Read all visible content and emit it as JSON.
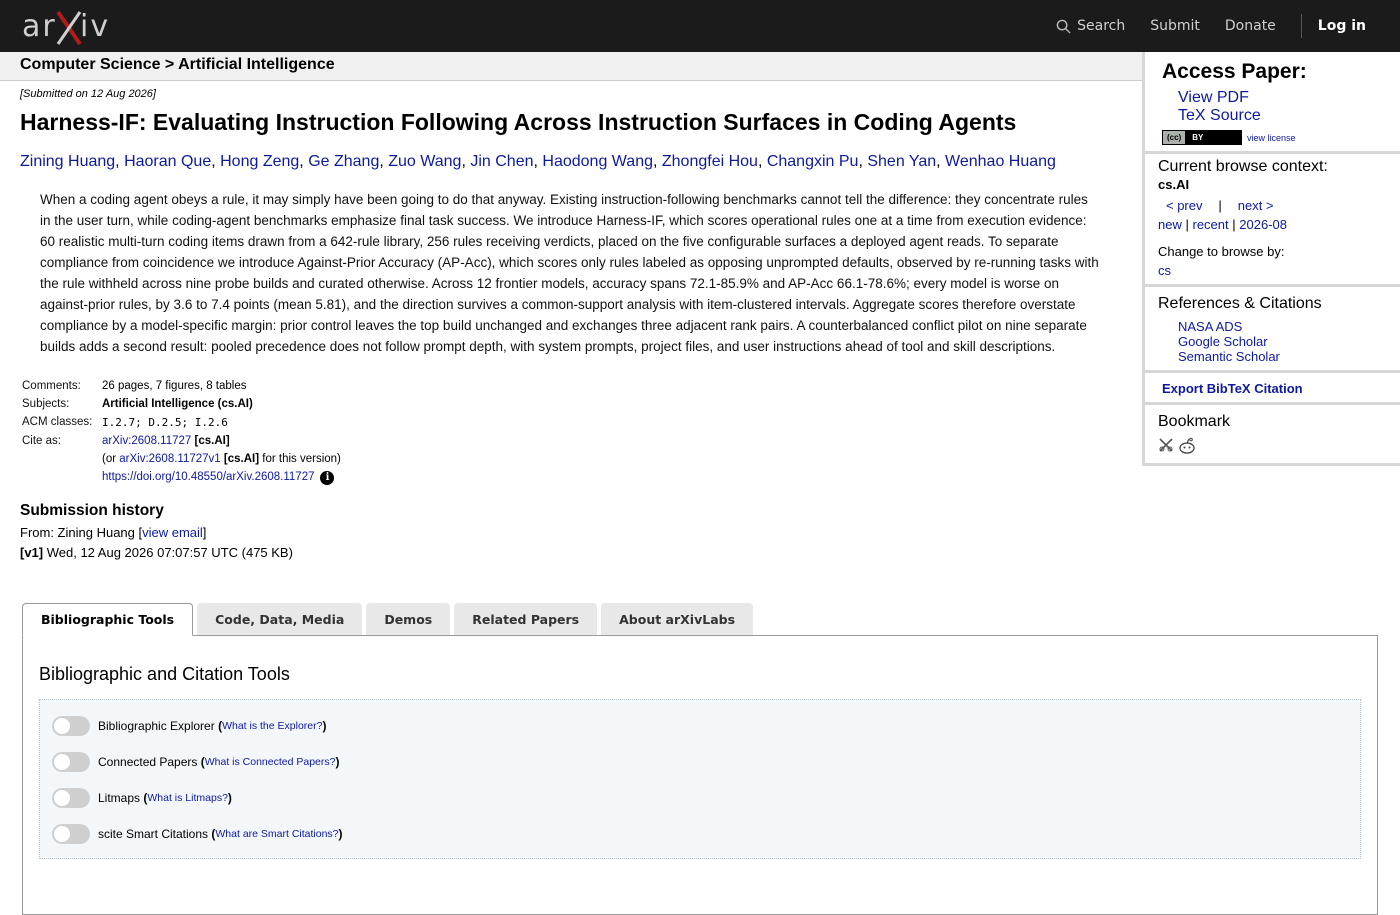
{
  "header": {
    "logo_text": "arXiv",
    "nav": {
      "search": "Search",
      "submit": "Submit",
      "donate": "Donate",
      "login": "Log in"
    }
  },
  "breadcrumb": "Computer Science > Artificial Intelligence",
  "paper": {
    "submitted": "[Submitted on 12 Aug 2026]",
    "title": "Harness-IF: Evaluating Instruction Following Across Instruction Surfaces in Coding Agents",
    "authors": [
      "Zining Huang",
      "Haoran Que",
      "Hong Zeng",
      "Ge Zhang",
      "Zuo Wang",
      "Jin Chen",
      "Haodong Wang",
      "Zhongfei Hou",
      "Changxin Pu",
      "Shen Yan",
      "Wenhao Huang"
    ],
    "abstract": "When a coding agent obeys a rule, it may simply have been going to do that anyway. Existing instruction-following benchmarks cannot tell the difference: they concentrate rules in the user turn, while coding-agent benchmarks emphasize final task success. We introduce Harness-IF, which scores operational rules one at a time from execution evidence: 60 realistic multi-turn coding items drawn from a 642-rule library, 256 rules receiving verdicts, placed on the five configurable surfaces a deployed agent reads. To separate compliance from coincidence we introduce Against-Prior Accuracy (AP-Acc), which scores only rules labeled as opposing unprompted defaults, observed by re-running tasks with the rule withheld across nine probe builds and curated otherwise. Across 12 frontier models, accuracy spans 72.1-85.9% and AP-Acc 66.1-78.6%; every model is worse on against-prior rules, by 3.6 to 7.4 points (mean 5.81), and the direction survives a common-support analysis with item-clustered intervals. Aggregate scores therefore overstate compliance by a model-specific margin: prior control leaves the top build unchanged and exchanges three adjacent rank pairs. A counterbalanced conflict pilot on nine separate builds adds a second result: pooled precedence does not follow prompt depth, with system prompts, project files, and user instructions ahead of tool and skill descriptions.",
    "meta": {
      "comments_label": "Comments:",
      "comments": "26 pages, 7 figures, 8 tables",
      "subjects_label": "Subjects:",
      "subjects": "Artificial Intelligence (cs.AI)",
      "acm_abbr": "ACM",
      "acm_label_rest": " classes:",
      "acm": "I.2.7; D.2.5; I.2.6",
      "cite_label": "Cite as:",
      "cite_id": "arXiv:2608.11727",
      "cite_cat": "[cs.AI]",
      "or_prefix": "(or ",
      "cite_v1": "arXiv:2608.11727v1",
      "cite_v1_cat": "[cs.AI]",
      "or_suffix": " for this version)",
      "doi": "https://doi.org/10.48550/arXiv.2608.11727"
    },
    "history": {
      "title": "Submission history",
      "from_prefix": "From: Zining Huang [",
      "view_email": "view email",
      "from_suffix": "]",
      "v1_label": "[v1]",
      "v1_text": " Wed, 12 Aug 2026 07:07:57 UTC (475 KB)"
    }
  },
  "sidebar": {
    "access_title": "Access Paper:",
    "view_pdf": "View PDF",
    "tex_source": "TeX Source",
    "cc_label": "(cc)",
    "by_label": "BY",
    "view_license": "view license",
    "context_title": "Current browse context:",
    "context": "cs.AI",
    "prev": "< prev",
    "sep": "|",
    "next": "next >",
    "new": "new",
    "recent": "recent",
    "month": "2026-08",
    "change_label": "Change to browse by:",
    "change_cat": "cs",
    "refs_title": "References & Citations",
    "refs": [
      "NASA ADS",
      "Google Scholar",
      "Semantic Scholar"
    ],
    "export": "Export BibTeX Citation",
    "bookmark_title": "Bookmark"
  },
  "tabs": [
    "Bibliographic Tools",
    "Code, Data, Media",
    "Demos",
    "Related Papers",
    "About arXivLabs"
  ],
  "panel": {
    "title": "Bibliographic and Citation Tools",
    "tools": [
      {
        "name": "Bibliographic Explorer",
        "help": "What is the Explorer?"
      },
      {
        "name": "Connected Papers",
        "help": "What is Connected Papers?"
      },
      {
        "name": "Litmaps",
        "help": "What is Litmaps?"
      },
      {
        "name": "scite Smart Citations",
        "help": "What are Smart Citations?"
      }
    ]
  },
  "colors": {
    "header_bg": "#1b1b1b",
    "link": "#0e1a9c",
    "logo_x": "#b31b1b"
  }
}
